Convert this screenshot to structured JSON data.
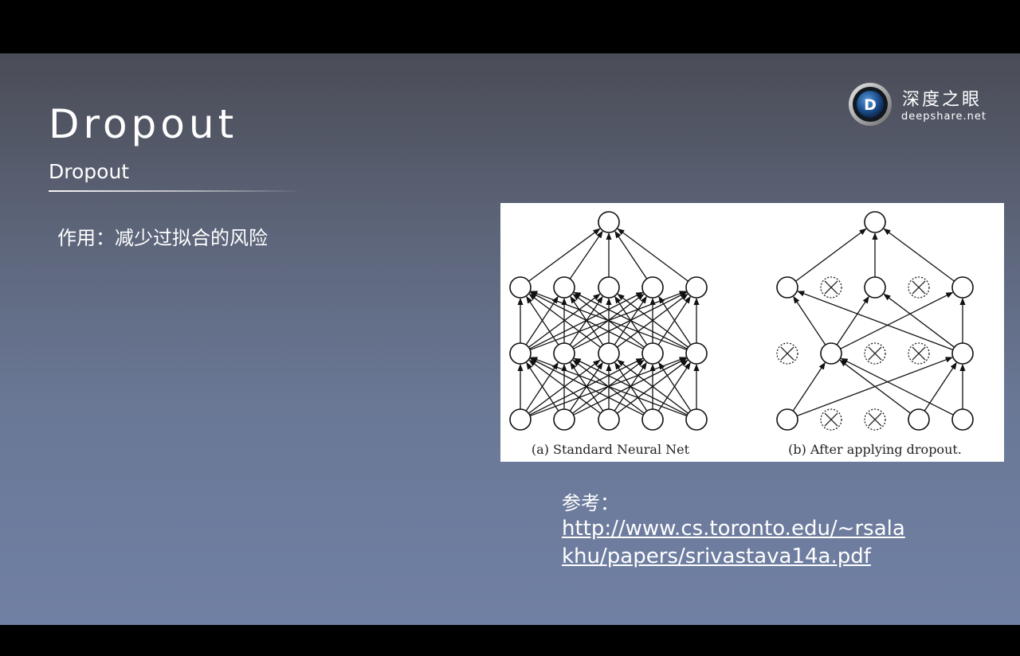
{
  "slide": {
    "title": "Dropout",
    "subtitle": "Dropout",
    "bullet": "作用：减少过拟合的风险"
  },
  "logo": {
    "name_cn": "深度之眼",
    "name_en": "deepshare.net",
    "mark_letter": "D"
  },
  "figure": {
    "left_caption": "(a) Standard Neural Net",
    "right_caption": "(b) After applying dropout."
  },
  "reference": {
    "label": "参考：",
    "link_line1": "http://www.cs.toronto.edu/~rsala",
    "link_line2": "khu/papers/srivastava14a.pdf"
  },
  "colors": {
    "background_top": "#4a4c56",
    "background_bottom": "#7080a4",
    "text": "#ffffff"
  }
}
